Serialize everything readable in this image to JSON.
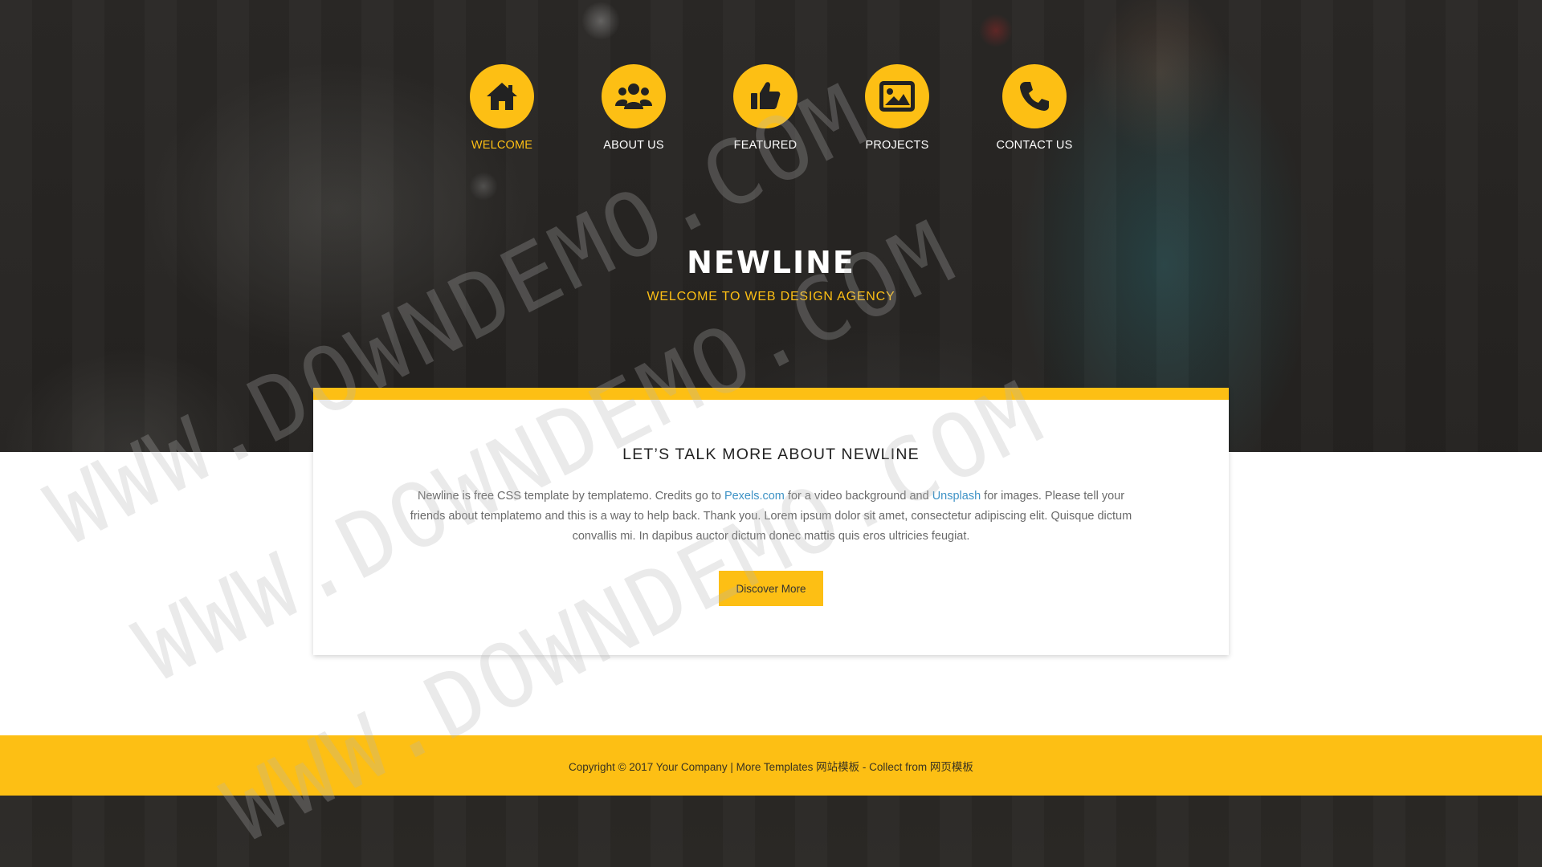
{
  "colors": {
    "accent": "#fdbf14",
    "link": "#3f93c6",
    "nav_text": "#ffffff",
    "body_text": "#6a6a6a"
  },
  "nav": {
    "items": [
      {
        "label": "WELCOME",
        "icon": "home-icon",
        "active": true
      },
      {
        "label": "ABOUT US",
        "icon": "users-icon",
        "active": false
      },
      {
        "label": "FEATURED",
        "icon": "thumbs-up-icon",
        "active": false
      },
      {
        "label": "PROJECTS",
        "icon": "image-icon",
        "active": false
      },
      {
        "label": "CONTACT US",
        "icon": "phone-icon",
        "active": false
      }
    ]
  },
  "hero": {
    "title": "NEWLINE",
    "subtitle": "WELCOME TO WEB DESIGN AGENCY"
  },
  "about": {
    "title": "LET’S TALK MORE ABOUT NEWLINE",
    "text_part1": "Newline is free CSS template by templatemo. Credits go to ",
    "link1": "Pexels.com",
    "text_part2": " for a video background and ",
    "link2": "Unsplash",
    "text_part3": " for images. Please tell your friends about templatemo and this is a way to help back. Thank you. Lorem ipsum dolor sit amet, consectetur adipiscing elit. Quisque dictum convallis mi. In dapibus auctor dictum donec mattis quis eros ultricies feugiat.",
    "button_label": "Discover More"
  },
  "footer": {
    "text": "Copyright © 2017 Your Company | More Templates 网站模板 - Collect from 网页模板"
  },
  "watermark": {
    "text": "WWW.DOWNDEMO.COM"
  }
}
